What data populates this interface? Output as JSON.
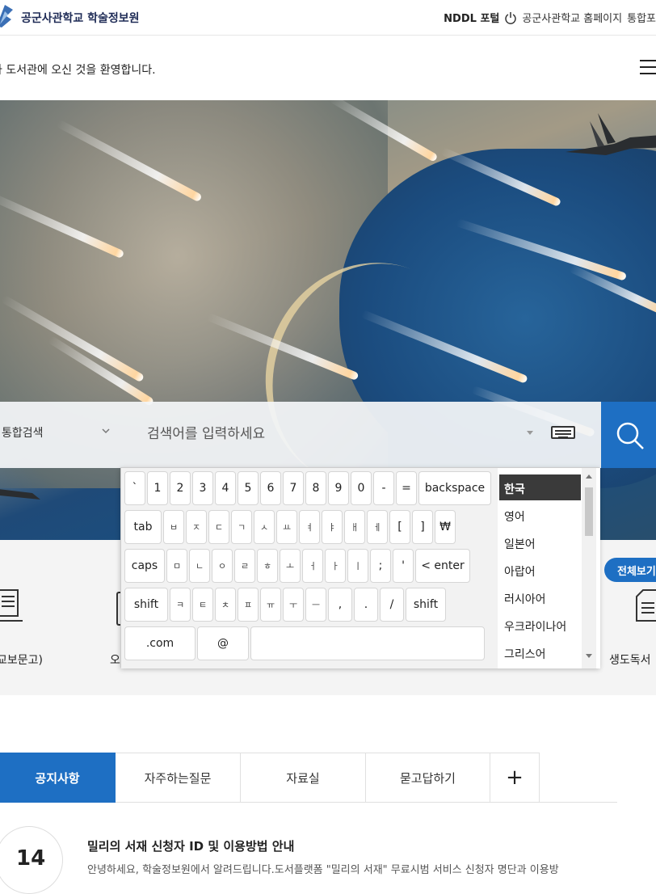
{
  "header": {
    "logo_text": "공군사관학교 학술정보원",
    "links": [
      "NDDL 포털",
      "공군사관학교 홈페이지",
      "통합포"
    ]
  },
  "welcome_text": "자 도서관에 오신 것을 환영합니다.",
  "search": {
    "scope": "통합검색",
    "placeholder": "검색어를 입력하세요"
  },
  "quick_services": {
    "left_label": "교보문고)",
    "mid_label": "오",
    "right_label": "생도독서",
    "view_all": "전체보기"
  },
  "keyboard": {
    "rows": [
      [
        "`",
        "1",
        "2",
        "3",
        "4",
        "5",
        "6",
        "7",
        "8",
        "9",
        "0",
        "-",
        "=",
        "backspace"
      ],
      [
        "tab",
        "ㅂ",
        "ㅈ",
        "ㄷ",
        "ㄱ",
        "ㅅ",
        "ㅛ",
        "ㅕ",
        "ㅑ",
        "ㅐ",
        "ㅔ",
        "[",
        "]",
        "₩"
      ],
      [
        "caps",
        "ㅁ",
        "ㄴ",
        "ㅇ",
        "ㄹ",
        "ㅎ",
        "ㅗ",
        "ㅓ",
        "ㅏ",
        "ㅣ",
        ";",
        "'",
        "< enter"
      ],
      [
        "shift",
        "ㅋ",
        "ㅌ",
        "ㅊ",
        "ㅍ",
        "ㅠ",
        "ㅜ",
        "ㅡ",
        ",",
        ".",
        "/",
        "shift"
      ],
      [
        ".com",
        "@",
        ""
      ]
    ],
    "languages": [
      "한국",
      "영어",
      "일본어",
      "아랍어",
      "러시아어",
      "우크라이나어",
      "그리스어"
    ],
    "selected_language": "한국"
  },
  "tabs": {
    "items": [
      "공지사항",
      "자주하는질문",
      "자료실",
      "묻고답하기"
    ],
    "plus": "+"
  },
  "notice": {
    "day": "14",
    "title": "밀리의 서재 신청자 ID 및 이용방법 안내",
    "body": "안녕하세요, 학술정보원에서 알려드립니다.도서플랫폼 \"밀리의 서재\" 무료시범 서비스 신청자 명단과 이용방"
  },
  "colors": {
    "accent": "#1e6fc3",
    "lang_active": "#3a3a3a"
  }
}
